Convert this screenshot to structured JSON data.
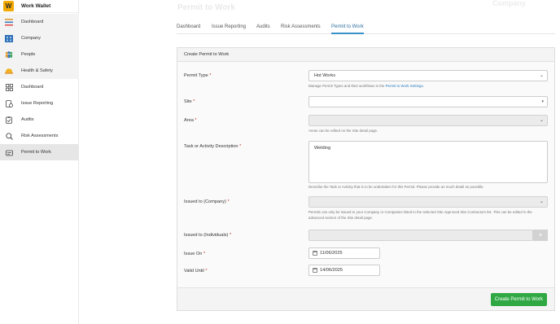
{
  "brand": {
    "logo_letter": "W",
    "name": "Work Wallet"
  },
  "sidebar": {
    "top_items": [
      {
        "label": "Dashboard",
        "icon": "menu-lines-icon"
      },
      {
        "label": "Company",
        "icon": "building-icon"
      },
      {
        "label": "People",
        "icon": "people-icon"
      },
      {
        "label": "Health & Safety",
        "icon": "hard-hat-icon"
      }
    ],
    "sub_items": [
      {
        "label": "Dashboard",
        "icon": "grid-icon"
      },
      {
        "label": "Issue Reporting",
        "icon": "issue-icon"
      },
      {
        "label": "Audits",
        "icon": "clipboard-icon"
      },
      {
        "label": "Risk Assessments",
        "icon": "magnifier-icon"
      },
      {
        "label": "Permit to Work",
        "icon": "permit-icon"
      }
    ]
  },
  "page": {
    "ghost_title": "Permit to Work",
    "ghost_logo": "Company"
  },
  "tabs": [
    "Dashboard",
    "Issue Reporting",
    "Audits",
    "Risk Assessments",
    "Permit to Work"
  ],
  "form": {
    "header": "Create Permit to Work",
    "permit_type": {
      "label": "Permit Type",
      "value": "Hot Works",
      "help_pre": "Manage Permit Types and their workflows in the",
      "help_link": "Permit to Work Settings",
      "help_post": "."
    },
    "site": {
      "label": "Site",
      "value": ""
    },
    "area": {
      "label": "Area",
      "value": "",
      "help": "Areas can be edited on the Site detail page."
    },
    "task": {
      "label": "Task or Activity Description",
      "value": "Welding",
      "help": "Describe the Task or Activity that is to be undertaken for this Permit. Please provide as much detail as possible."
    },
    "issued_company": {
      "label": "Issued to (Company)",
      "value": "",
      "help": "Permits can only be issued to your Company or Companies listed in the selected Site Approved Site Contractors list. This can be edited in the advanced section of the Site detail page."
    },
    "issued_individuals": {
      "label": "Issued to (Individuals)",
      "plus": "+"
    },
    "issue_on": {
      "label": "Issue On",
      "value": "11/06/2025"
    },
    "valid_until": {
      "label": "Valid Until",
      "value": "14/06/2025"
    },
    "required_marker": "*",
    "submit_label": "Create Permit to Work"
  },
  "colors": {
    "accent": "#3a8fc9",
    "submit": "#2fa844",
    "brand": "#f2a900"
  }
}
